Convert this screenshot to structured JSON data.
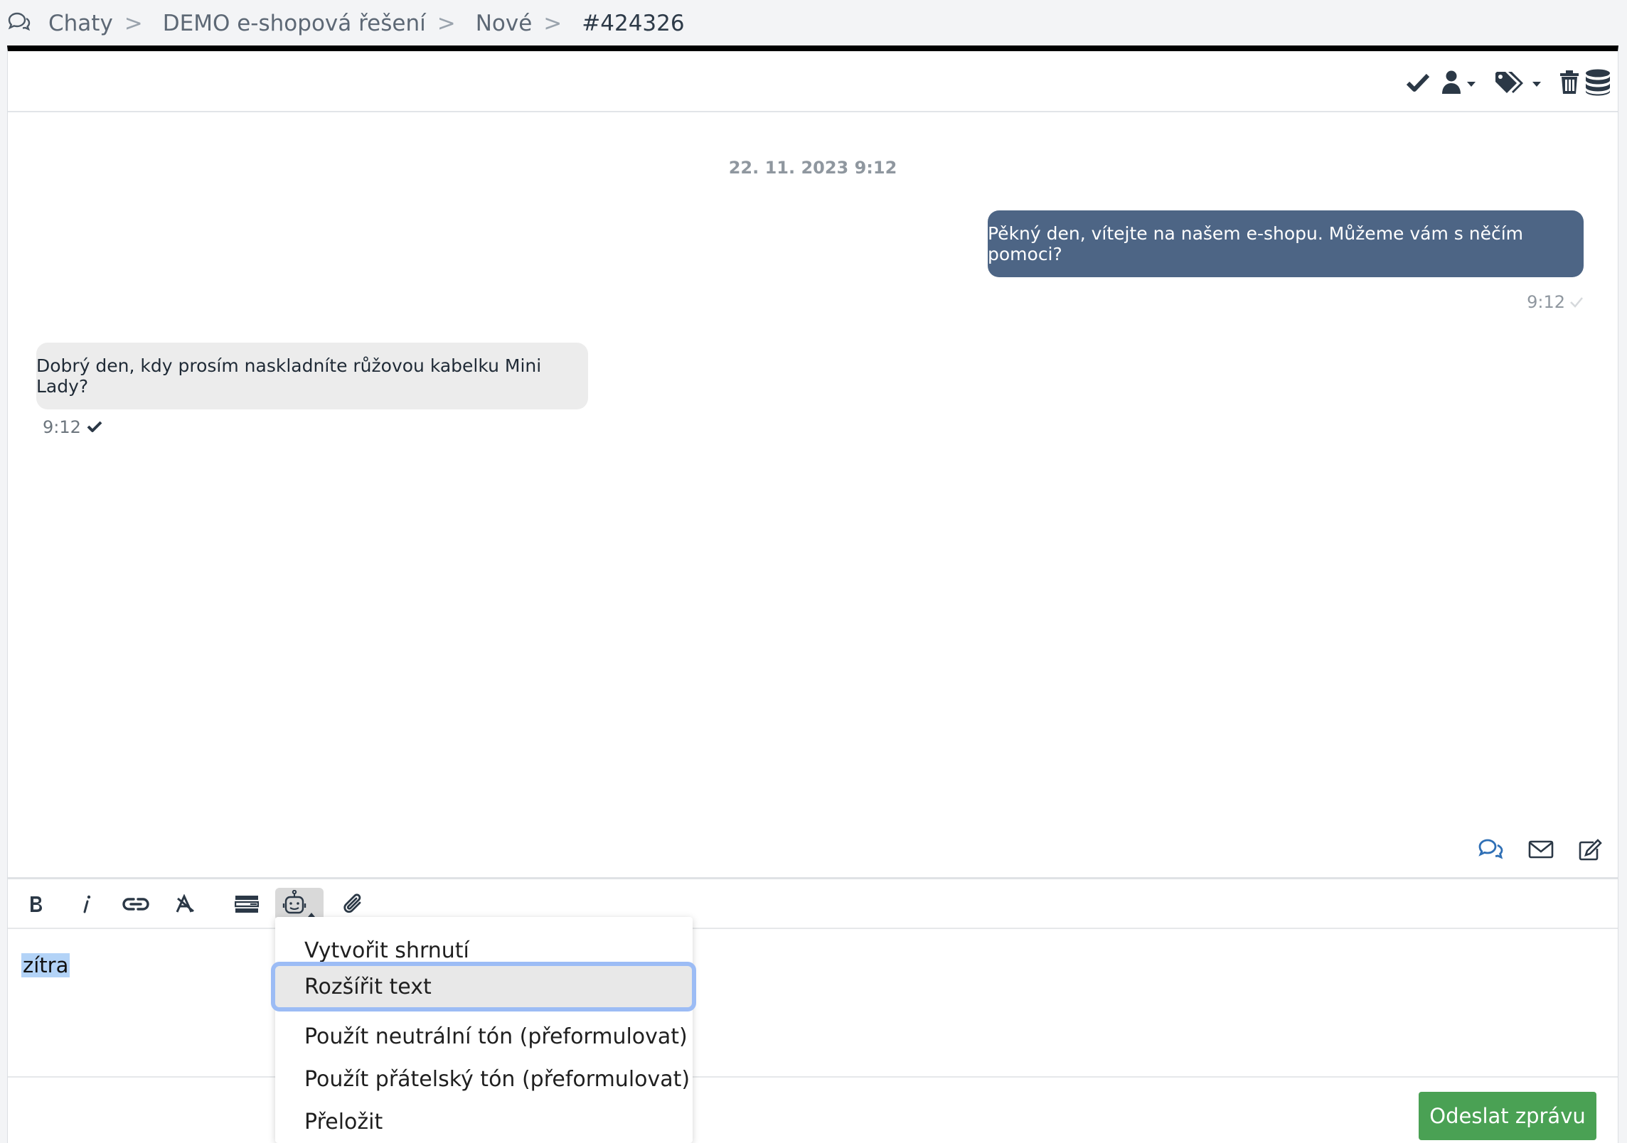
{
  "breadcrumb": {
    "items": [
      "Chaty",
      "DEMO e-shopová řešení",
      "Nové"
    ],
    "separator": ">",
    "current": "#424326"
  },
  "chat": {
    "date": "22. 11. 2023 9:12",
    "outgoing": {
      "text": "Pěkný den, vítejte na našem e-shopu. Můžeme vám s něčím pomoci?",
      "time": "9:12"
    },
    "incoming": {
      "text": "Dobrý den, kdy prosím naskladníte růžovou kabelku Mini Lady?",
      "time": "9:12"
    }
  },
  "editor": {
    "text": "zítra",
    "toolbar": [
      "bold-icon",
      "italic-icon",
      "link-icon",
      "clear-format-icon",
      "template-icon",
      "ai-robot-icon",
      "attachment-icon"
    ]
  },
  "ai_menu": {
    "items": [
      "Vytvořit shrnutí",
      "Rozšířit text",
      "Použít neutrální tón (přeformulovat)",
      "Použít přátelský tón (přeformulovat)",
      "Přeložit"
    ],
    "focused_index": 1
  },
  "send_label": "Odeslat zprávu",
  "colors": {
    "outgoing_bubble": "#4d6585",
    "incoming_bubble": "#ececec",
    "send_button": "#4aa154",
    "focus_ring": "#9cbcf5",
    "channel_icon_active": "#2f6fb5"
  }
}
